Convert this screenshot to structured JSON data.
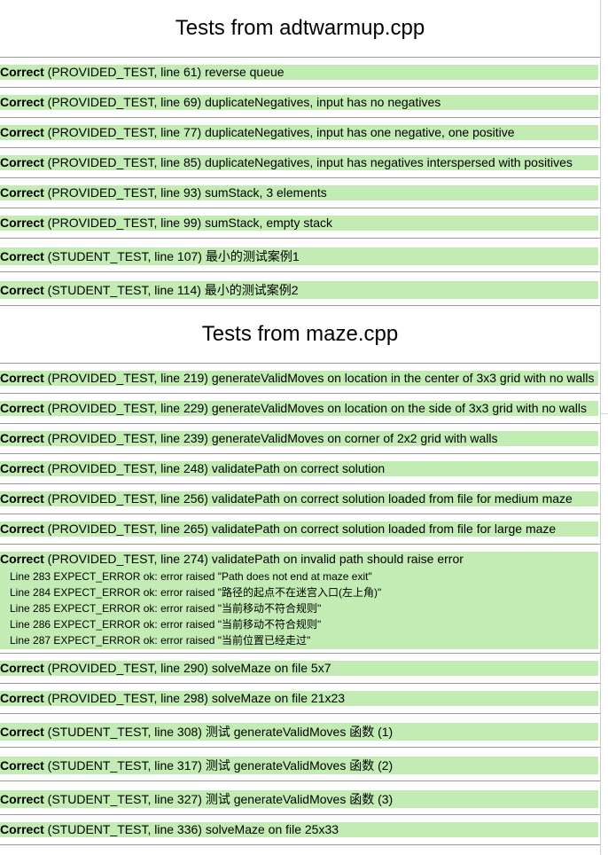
{
  "sections": [
    {
      "title": "Tests from adtwarmup.cpp",
      "tests": [
        {
          "status": "Correct",
          "info": " (PROVIDED_TEST, line 61) reverse queue"
        },
        {
          "status": "Correct",
          "info": " (PROVIDED_TEST, line 69) duplicateNegatives, input has no negatives"
        },
        {
          "status": "Correct",
          "info": " (PROVIDED_TEST, line 77) duplicateNegatives, input has one negative, one positive"
        },
        {
          "status": "Correct",
          "info": " (PROVIDED_TEST, line 85) duplicateNegatives, input has negatives interspersed with positives"
        },
        {
          "status": "Correct",
          "info": " (PROVIDED_TEST, line 93) sumStack, 3 elements"
        },
        {
          "status": "Correct",
          "info": " (PROVIDED_TEST, line 99) sumStack, empty stack"
        },
        {
          "status": "Correct",
          "info": " (STUDENT_TEST, line 107) 最小的测试案例1"
        },
        {
          "status": "Correct",
          "info": " (STUDENT_TEST, line 114) 最小的测试案例2"
        }
      ]
    },
    {
      "title": "Tests from maze.cpp",
      "tests": [
        {
          "status": "Correct",
          "info": " (PROVIDED_TEST, line 219) generateValidMoves on location in the center of 3x3 grid with no walls"
        },
        {
          "status": "Correct",
          "info": " (PROVIDED_TEST, line 229) generateValidMoves on location on the side of 3x3 grid with no walls"
        },
        {
          "status": "Correct",
          "info": " (PROVIDED_TEST, line 239) generateValidMoves on corner of 2x2 grid with walls"
        },
        {
          "status": "Correct",
          "info": " (PROVIDED_TEST, line 248) validatePath on correct solution"
        },
        {
          "status": "Correct",
          "info": " (PROVIDED_TEST, line 256) validatePath on correct solution loaded from file for medium maze"
        },
        {
          "status": "Correct",
          "info": " (PROVIDED_TEST, line 265) validatePath on correct solution loaded from file for large maze"
        },
        {
          "status": "Correct",
          "info": " (PROVIDED_TEST, line 274) validatePath on invalid path should raise error",
          "details": [
            "Line 283 EXPECT_ERROR ok: error raised \"Path does not end at maze exit\"",
            "Line 284 EXPECT_ERROR ok: error raised \"路径的起点不在迷宫入口(左上角)\"",
            "Line 285 EXPECT_ERROR ok: error raised \"当前移动不符合规则\"",
            "Line 286 EXPECT_ERROR ok: error raised \"当前移动不符合规则\"",
            "Line 287 EXPECT_ERROR ok: error raised \"当前位置已经走过\""
          ]
        },
        {
          "status": "Correct",
          "info": " (PROVIDED_TEST, line 290) solveMaze on file 5x7"
        },
        {
          "status": "Correct",
          "info": " (PROVIDED_TEST, line 298) solveMaze on file 21x23"
        },
        {
          "status": "Correct",
          "info": " (STUDENT_TEST, line 308) 测试 generateValidMoves 函数 (1)"
        },
        {
          "status": "Correct",
          "info": " (STUDENT_TEST, line 317) 测试 generateValidMoves 函数 (2)"
        },
        {
          "status": "Correct",
          "info": " (STUDENT_TEST, line 327) 测试 generateValidMoves 函数 (3)"
        },
        {
          "status": "Correct",
          "info": " (STUDENT_TEST, line 336) solveMaze on file 25x33"
        }
      ]
    }
  ],
  "colors": {
    "pass_bar": "#c2ecb3",
    "row_border": "#9a9a9a",
    "background": "#ffffff"
  }
}
